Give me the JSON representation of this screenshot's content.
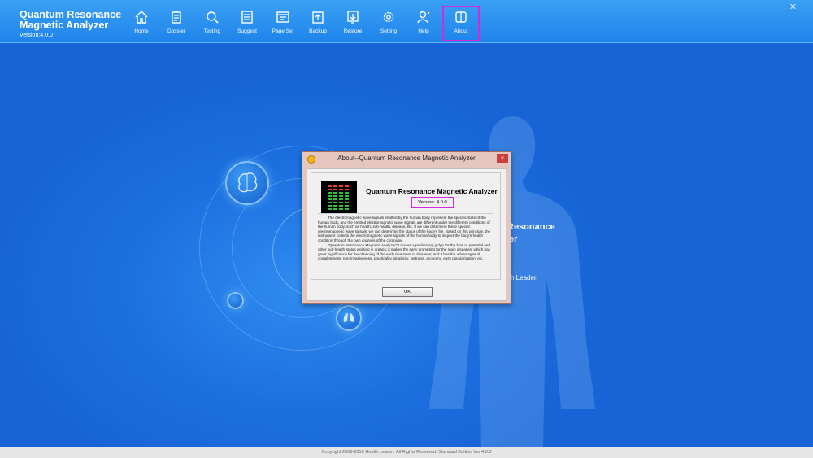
{
  "app": {
    "title": "Quantum Resonance Magnetic Analyzer",
    "version": "Version:4.0.0"
  },
  "toolbar": [
    {
      "label": "Home",
      "icon": "home-icon"
    },
    {
      "label": "Dossier",
      "icon": "dossier-icon"
    },
    {
      "label": "Testing",
      "icon": "magnifier-icon"
    },
    {
      "label": "Suggest",
      "icon": "list-icon"
    },
    {
      "label": "Page Set",
      "icon": "page-icon"
    },
    {
      "label": "Backup",
      "icon": "upload-icon"
    },
    {
      "label": "Restore",
      "icon": "download-icon"
    },
    {
      "label": "Setting",
      "icon": "gear-icon"
    },
    {
      "label": "Help",
      "icon": "user-help-icon"
    },
    {
      "label": "About",
      "icon": "book-icon"
    }
  ],
  "window": {
    "close_glyph": "✕"
  },
  "background": {
    "line1": "Resonance",
    "line2": "er",
    "line3": "lth Leader."
  },
  "dialog": {
    "title": "About--Quantum Resonance Magnetic Analyzer",
    "close_glyph": "×",
    "product_name": "Quantum Resonance Magnetic Analyzer",
    "version": "Version: 4.0.0",
    "paragraph1": "The electromagnetic wave signals emitted by the human body represent the specific state of the human body, and the emitted electromagnetic wave signals are different under the different conditions of the human body, such as health, sub-health, disease, etc. If we can determine these specific electromagnetic wave signals, we can determine the status of the body's life. Based on this principle, the instrument collects the electromagnetic wave signals of the human body to inspect the body's health condition through the own analysis of the computer.",
    "paragraph2": "\"Quantum Resonance Magnetic Analyzer\"It makes a preliminary judge for the bias or potential and other sub-health status existing in organs; it makes the early prompting for the main diseases, which has great significance for the obtaining of the early treatment of diseases; and it has the advantages of completeness, non-invasiveness, practicality, simplicity, fastness, economy, easy popularization, etc.",
    "ok_label": "OK"
  },
  "status_bar": "Copyright 2008-2016 Health Leader. All Rights Reserved.   Standard Edition Ver 4.0.0",
  "colors": {
    "accent": "#1f84ea",
    "highlight": "#d42bd9"
  }
}
